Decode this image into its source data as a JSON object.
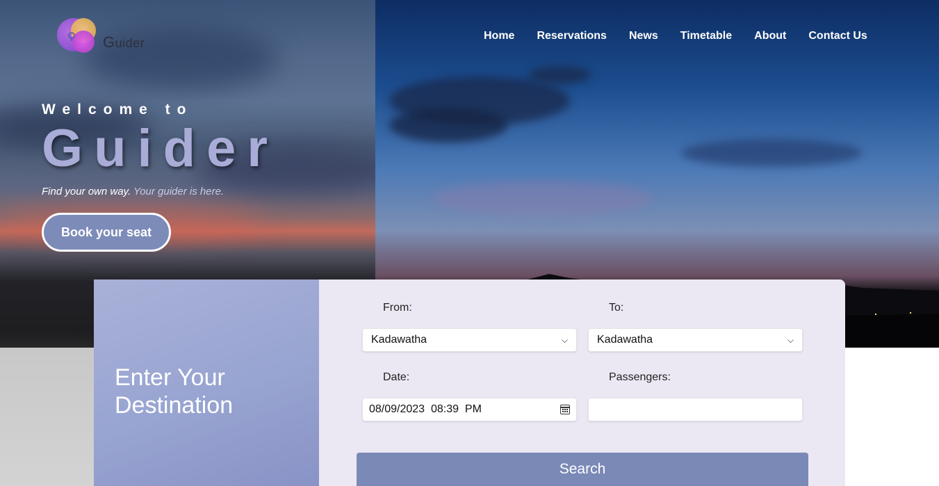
{
  "logo": {
    "text_initial": "G",
    "text_rest": "uider"
  },
  "nav": {
    "items": [
      {
        "label": "Home"
      },
      {
        "label": "Reservations"
      },
      {
        "label": "News"
      },
      {
        "label": "Timetable"
      },
      {
        "label": "About"
      },
      {
        "label": "Contact Us"
      }
    ]
  },
  "hero": {
    "welcome": "Welcome to",
    "brand": "Guider",
    "tagline_main": "Find your own way.",
    "tagline_muted": "Your guider is here.",
    "cta_label": "Book your seat"
  },
  "booking": {
    "panel_title_line1": "Enter Your",
    "panel_title_line2": "Destination",
    "from_label": "From:",
    "from_value": "Kadawatha",
    "to_label": "To:",
    "to_value": "Kadawatha",
    "date_label": "Date:",
    "date_value": "08/09/2023  08:39  PM",
    "passengers_label": "Passengers:",
    "passengers_value": "",
    "search_label": "Search"
  },
  "colors": {
    "accent": "#7a89b6",
    "brand_text": "#a8acd6",
    "form_bg": "#ebe8f3",
    "panel_bg": "#98a4d1"
  },
  "icons": [
    "logo-icon",
    "calendar-icon",
    "chevron-down-icon"
  ]
}
